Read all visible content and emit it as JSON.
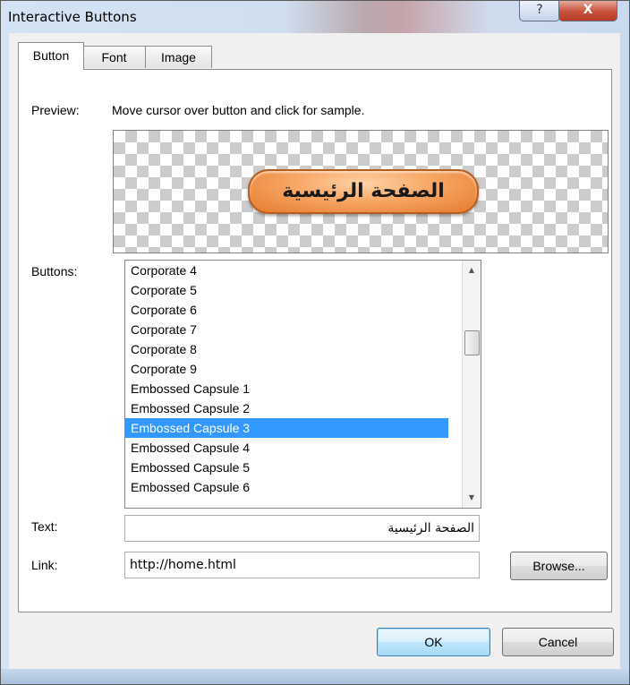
{
  "window": {
    "title": "Interactive Buttons",
    "help_glyph": "?",
    "close_glyph": "X"
  },
  "tabs": [
    {
      "label": "Button",
      "active": true
    },
    {
      "label": "Font",
      "active": false
    },
    {
      "label": "Image",
      "active": false
    }
  ],
  "preview": {
    "label": "Preview:",
    "hint": "Move cursor over button and click for sample.",
    "sample_text": "الصفحة الرئيسية"
  },
  "buttons_list": {
    "label": "Buttons:",
    "items": [
      "Corporate 4",
      "Corporate 5",
      "Corporate 6",
      "Corporate 7",
      "Corporate 8",
      "Corporate 9",
      "Embossed Capsule 1",
      "Embossed Capsule 2",
      "Embossed Capsule 3",
      "Embossed Capsule 4",
      "Embossed Capsule 5",
      "Embossed Capsule 6"
    ],
    "selected": "Embossed Capsule 3",
    "scroll_up_glyph": "▲",
    "scroll_down_glyph": "▼"
  },
  "text_field": {
    "label": "Text:",
    "value": "الصفحة الرئيسية"
  },
  "link_field": {
    "label": "Link:",
    "value": "http://home.html",
    "browse_label": "Browse..."
  },
  "footer": {
    "ok_label": "OK",
    "cancel_label": "Cancel"
  },
  "colors": {
    "selection": "#3399ff",
    "capsule_orange": "#f7a563"
  }
}
